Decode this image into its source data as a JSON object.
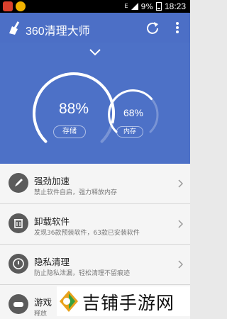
{
  "status_bar": {
    "battery": "9%",
    "time": "18:23",
    "signal": "E"
  },
  "app": {
    "title": "360清理大师",
    "refresh_icon": "refresh-icon",
    "more_icon": "more-vertical-icon"
  },
  "hero": {
    "storage": {
      "value": "88%",
      "label": "存储",
      "fraction": 0.88
    },
    "memory": {
      "value": "68%",
      "label": "内存",
      "fraction": 0.68
    }
  },
  "list": {
    "items": [
      {
        "title": "强劲加速",
        "subtitle": "禁止软件自启，强力释放内存",
        "icon": "rocket-icon"
      },
      {
        "title": "卸载软件",
        "subtitle": "发现36款预装软件，63款已安装软件",
        "icon": "trash-icon"
      },
      {
        "title": "隐私清理",
        "subtitle": "防止隐私泄漏，轻松清理不留痕迹",
        "icon": "privacy-lock-icon"
      },
      {
        "title": "游戏",
        "subtitle": "释放",
        "icon": "gamepad-icon"
      }
    ]
  },
  "watermark": {
    "text": "吉铺手游网"
  },
  "colors": {
    "header": "#4c6fc6",
    "hero": "#4d71c7",
    "list_bg": "#f5f5f5"
  }
}
